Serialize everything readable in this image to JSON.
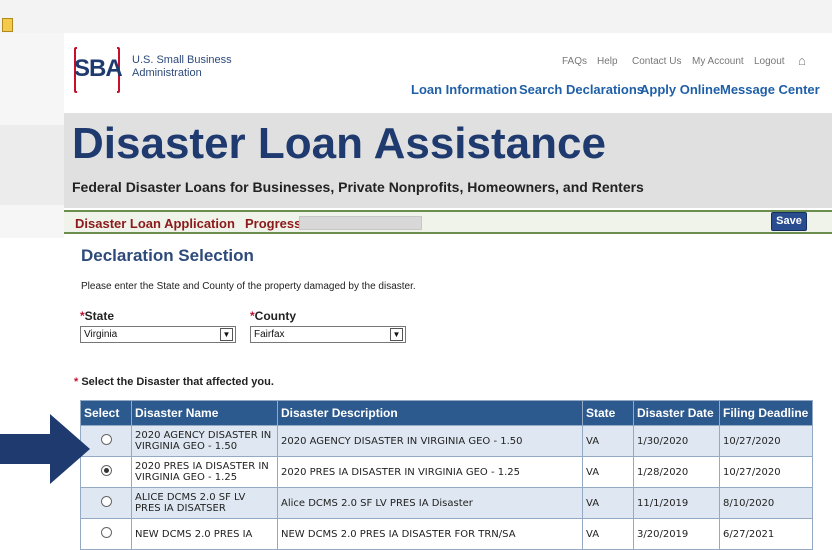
{
  "header": {
    "logo_text": "SBA",
    "agency_line1": "U.S. Small Business",
    "agency_line2": "Administration",
    "utility_links": [
      "FAQs",
      "Help",
      "Contact Us",
      "My Account",
      "Logout"
    ],
    "main_nav": [
      "Loan Information",
      "Search Declarations",
      "Apply Online",
      "Message Center"
    ]
  },
  "banner": {
    "title": "Disaster Loan Assistance",
    "subtitle": "Federal Disaster Loans for Businesses, Private Nonprofits, Homeowners, and Renters"
  },
  "app_nav": {
    "application_label": "Disaster Loan Application",
    "progress_label": "Progress",
    "save_label": "Save"
  },
  "section": {
    "title": "Declaration Selection",
    "instructions": "Please enter the State and County of the property damaged by the disaster."
  },
  "form": {
    "state_label": "State",
    "state_value": "Virginia",
    "county_label": "County",
    "county_value": "Fairfax",
    "required_marker": "*",
    "disaster_prompt": "Select the Disaster that affected you."
  },
  "table": {
    "headers": [
      "Select",
      "Disaster Name",
      "Disaster Description",
      "State",
      "Disaster Date",
      "Filing Deadline"
    ],
    "rows": [
      {
        "selected": false,
        "name": "2020 AGENCY DISASTER IN VIRGINIA GEO - 1.50",
        "description": "2020 AGENCY DISASTER IN VIRGINIA GEO - 1.50",
        "state": "VA",
        "date": "1/30/2020",
        "deadline": "10/27/2020"
      },
      {
        "selected": true,
        "name": "2020 PRES IA DISASTER IN VIRGINIA GEO - 1.25",
        "description": "2020 PRES IA DISASTER IN VIRGINIA GEO - 1.25",
        "state": "VA",
        "date": "1/28/2020",
        "deadline": "10/27/2020"
      },
      {
        "selected": false,
        "name": "ALICE DCMS 2.0 SF LV PRES IA DISATSER",
        "description": "Alice DCMS 2.0 SF LV PRES IA Disaster",
        "state": "VA",
        "date": "11/1/2019",
        "deadline": "8/10/2020"
      },
      {
        "selected": false,
        "name": "NEW DCMS 2.0 PRES IA",
        "description": "NEW DCMS 2.0 PRES IA DISASTER FOR TRN/SA",
        "state": "VA",
        "date": "3/20/2019",
        "deadline": "6/27/2021"
      }
    ]
  },
  "colors": {
    "brand_navy": "#1f3a6e",
    "link_blue": "#1f5fa8",
    "required_red": "#c8102e",
    "table_header": "#2d5a8e",
    "pointer_arrow": "#1f3a6e"
  },
  "icons": {
    "home": "home-icon",
    "pointer": "pointer-arrow-icon"
  }
}
